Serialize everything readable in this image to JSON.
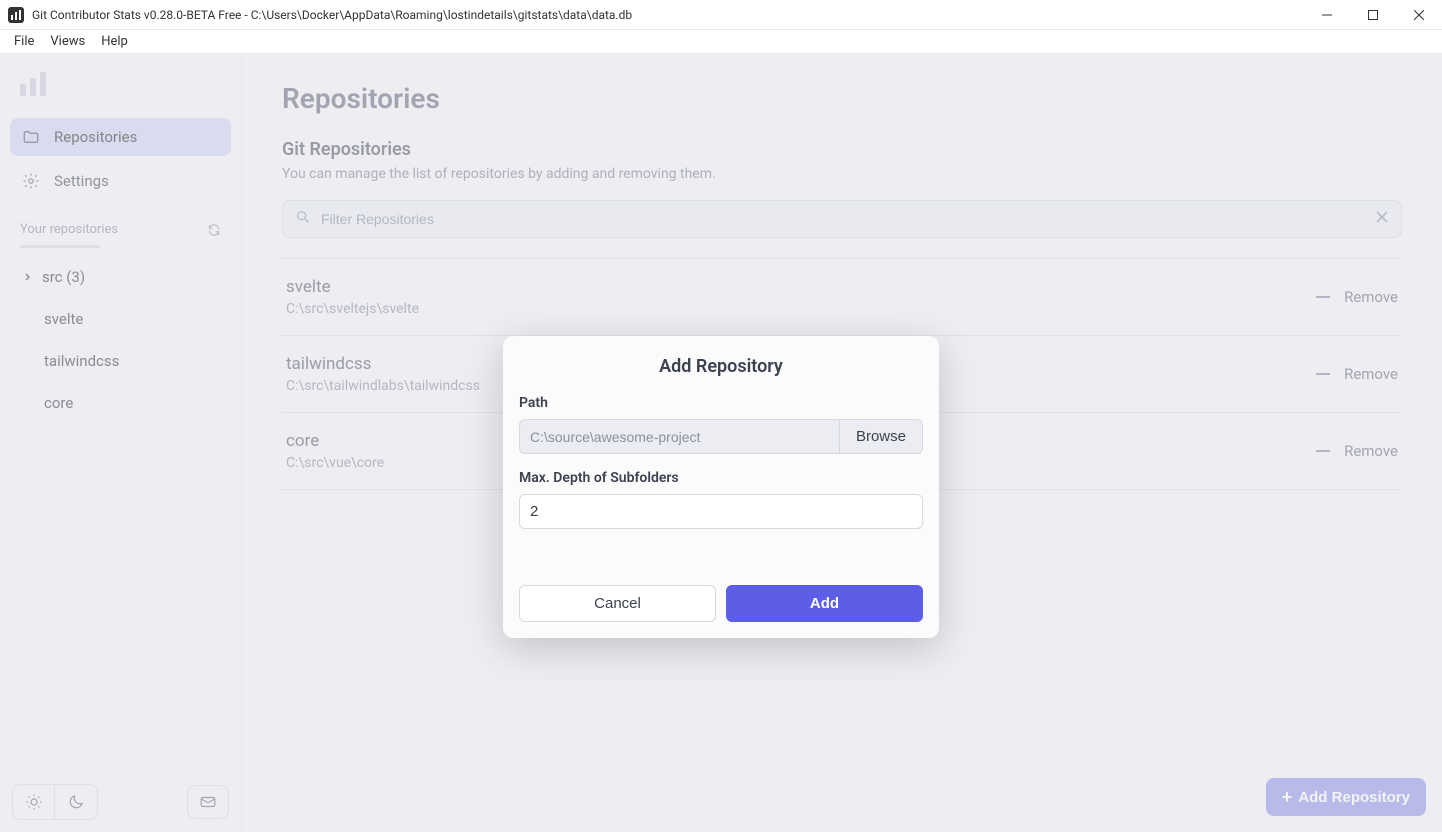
{
  "window": {
    "title": "Git Contributor Stats v0.28.0-BETA Free - C:\\Users\\Docker\\AppData\\Roaming\\lostindetails\\gitstats\\data\\data.db"
  },
  "menubar": {
    "file": "File",
    "views": "Views",
    "help": "Help"
  },
  "sidebar": {
    "nav": {
      "repositories": "Repositories",
      "settings": "Settings"
    },
    "section_label": "Your repositories",
    "tree": {
      "folder": "src (3)",
      "items": [
        "svelte",
        "tailwindcss",
        "core"
      ]
    }
  },
  "page": {
    "title": "Repositories",
    "section_title": "Git Repositories",
    "section_desc": "You can manage the list of repositories by adding and removing them.",
    "filter_placeholder": "Filter Repositories",
    "remove_label": "Remove",
    "repos": [
      {
        "name": "svelte",
        "path": "C:\\src\\sveltejs\\svelte"
      },
      {
        "name": "tailwindcss",
        "path": "C:\\src\\tailwindlabs\\tailwindcss"
      },
      {
        "name": "core",
        "path": "C:\\src\\vue\\core"
      }
    ],
    "add_button": "Add Repository"
  },
  "modal": {
    "title": "Add Repository",
    "path_label": "Path",
    "path_placeholder": "C:\\source\\awesome-project",
    "browse": "Browse",
    "depth_label": "Max. Depth of Subfolders",
    "depth_value": "2",
    "cancel": "Cancel",
    "add": "Add"
  }
}
